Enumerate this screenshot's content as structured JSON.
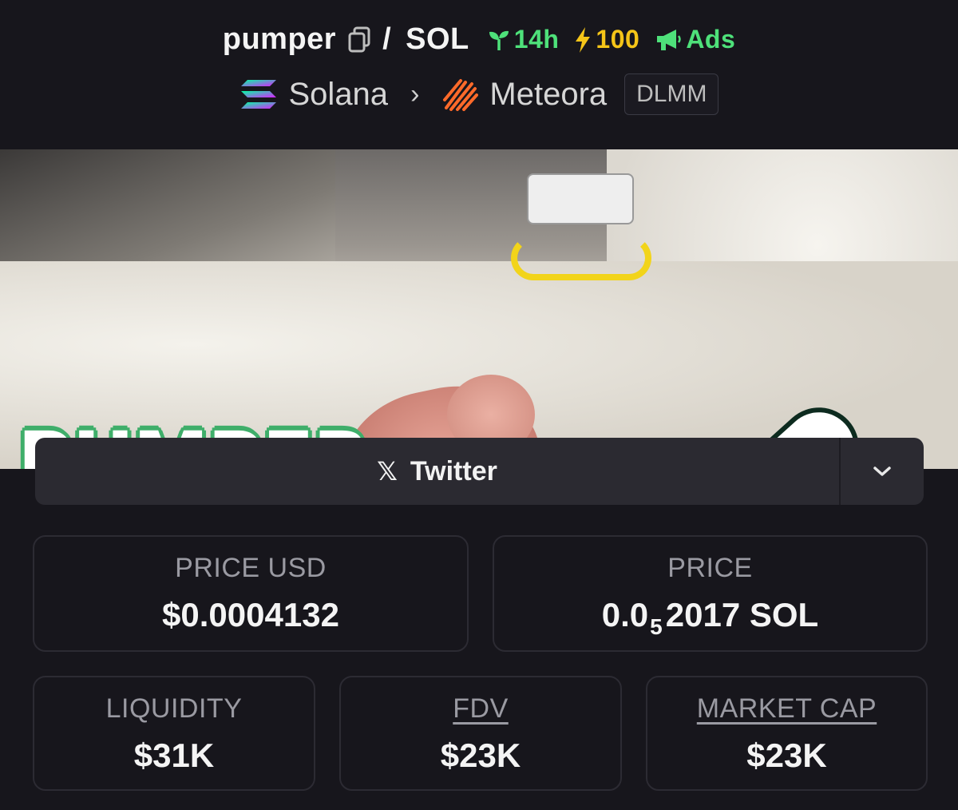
{
  "header": {
    "token": "pumper",
    "separator": "/",
    "quote": "SOL",
    "age_badge": "14h",
    "boost_badge": "100",
    "ads_badge": "Ads",
    "chain": "Solana",
    "dex": "Meteora",
    "pool_type": "DLMM",
    "icons": [
      "copy-icon",
      "sprout-icon",
      "bolt-icon",
      "megaphone-icon",
      "solana-logo",
      "meteora-logo",
      "chevron-right-icon"
    ]
  },
  "banner": {
    "headline": "PUMPER"
  },
  "socials": {
    "twitter_label": "Twitter",
    "more_icon": "chevron-down-icon"
  },
  "stats": {
    "price_usd": {
      "label": "PRICE USD",
      "value": "$0.0004132"
    },
    "price_native": {
      "label": "PRICE",
      "prefix": "0.0",
      "zeros": "5",
      "suffix": "2017 SOL"
    },
    "liquidity": {
      "label": "LIQUIDITY",
      "value": "$31K"
    },
    "fdv": {
      "label": "FDV",
      "value": "$23K"
    },
    "market_cap": {
      "label": "MARKET CAP",
      "value": "$23K"
    }
  },
  "colors": {
    "background": "#17161c",
    "age_green": "#4ee17a",
    "boost_yellow": "#f5c518",
    "card_border": "#2c2b33",
    "label_gray": "#9a9aa2"
  }
}
